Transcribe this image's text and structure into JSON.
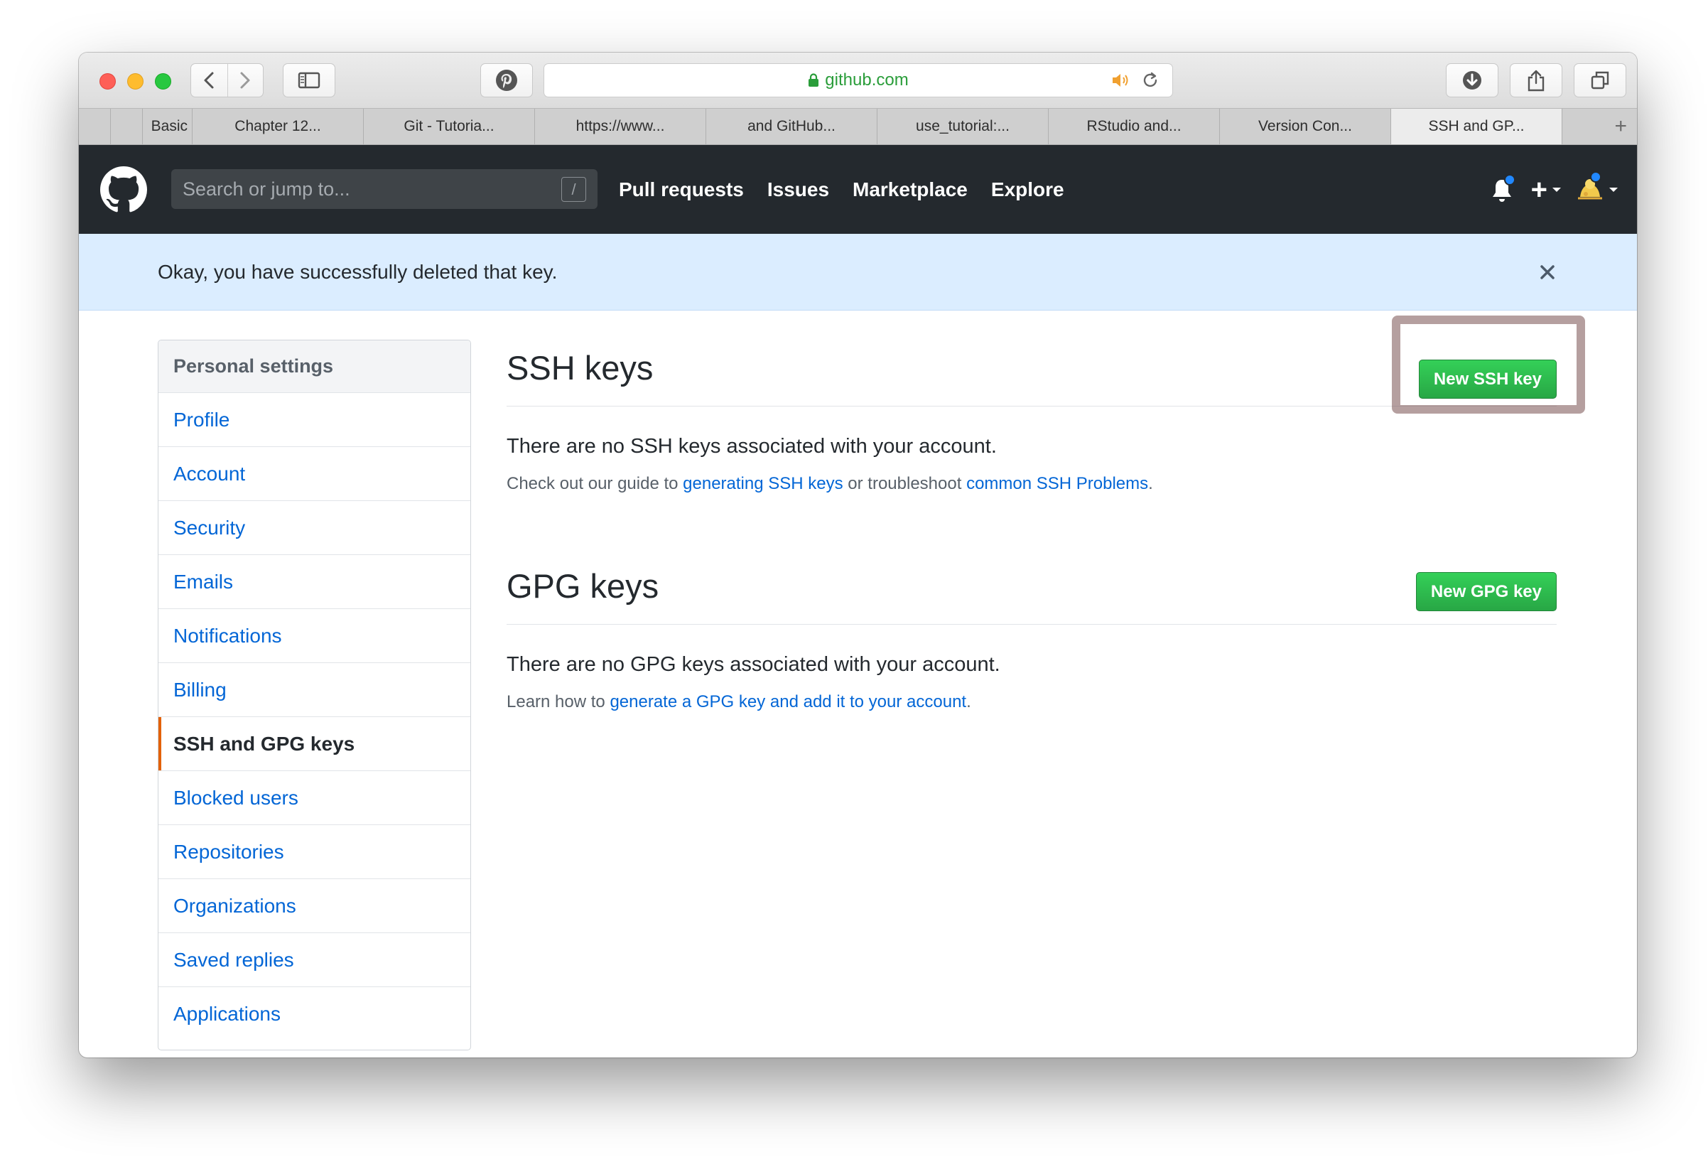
{
  "browser": {
    "url": "github.com",
    "tabs": [
      {
        "label": ""
      },
      {
        "label": ""
      },
      {
        "label": "Basic"
      },
      {
        "label": "Chapter 12..."
      },
      {
        "label": "Git - Tutoria..."
      },
      {
        "label": "https://www..."
      },
      {
        "label": "and GitHub..."
      },
      {
        "label": "use_tutorial:..."
      },
      {
        "label": "RStudio and..."
      },
      {
        "label": "Version Con..."
      },
      {
        "label": "SSH and GP..."
      }
    ],
    "new_tab_label": "+"
  },
  "github_header": {
    "search_placeholder": "Search or jump to...",
    "search_shortcut": "/",
    "nav": [
      "Pull requests",
      "Issues",
      "Marketplace",
      "Explore"
    ],
    "create_label": "+"
  },
  "flash": {
    "message": "Okay, you have successfully deleted that key."
  },
  "settings_menu": {
    "heading": "Personal settings",
    "items": [
      {
        "label": "Profile"
      },
      {
        "label": "Account"
      },
      {
        "label": "Security"
      },
      {
        "label": "Emails"
      },
      {
        "label": "Notifications"
      },
      {
        "label": "Billing"
      },
      {
        "label": "SSH and GPG keys"
      },
      {
        "label": "Blocked users"
      },
      {
        "label": "Repositories"
      },
      {
        "label": "Organizations"
      },
      {
        "label": "Saved replies"
      },
      {
        "label": "Applications"
      }
    ],
    "selected_index": 6
  },
  "ssh": {
    "title": "SSH keys",
    "button": "New SSH key",
    "blank": "There are no SSH keys associated with your account.",
    "guide_prefix": "Check out our guide to ",
    "guide_link1": "generating SSH keys",
    "guide_middle": " or troubleshoot ",
    "guide_link2": "common SSH Problems",
    "guide_suffix": "."
  },
  "gpg": {
    "title": "GPG keys",
    "button": "New GPG key",
    "blank": "There are no GPG keys associated with your account.",
    "guide_prefix": "Learn how to ",
    "guide_link": "generate a GPG key and add it to your account",
    "guide_suffix": "."
  },
  "colors": {
    "header_bg": "#24292e",
    "flash_bg": "#dbedff",
    "link": "#0366d6",
    "button_green": "#28a745",
    "selected_accent": "#e36209",
    "url_green": "#2a9d3a"
  }
}
